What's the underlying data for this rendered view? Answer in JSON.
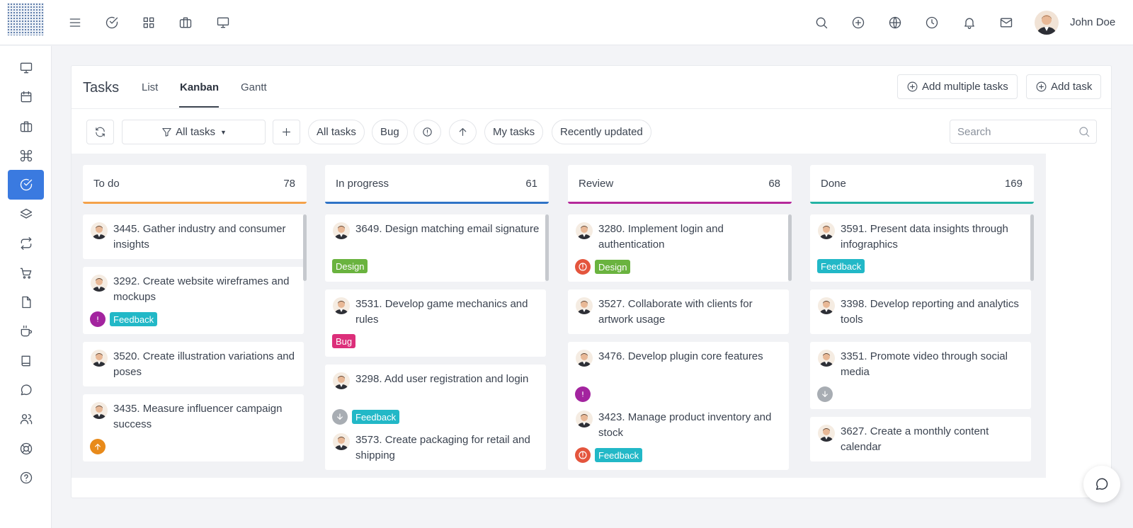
{
  "topbar": {
    "user_name": "John Doe",
    "left_icons": [
      "menu-icon",
      "check-circle-icon",
      "grid-icon",
      "briefcase-icon",
      "monitor-icon"
    ],
    "right_icons": [
      "search-icon",
      "plus-circle-icon",
      "globe-icon",
      "clock-icon",
      "bell-icon",
      "mail-icon"
    ]
  },
  "sidebar": {
    "items": [
      {
        "icon": "monitor-icon",
        "active": false
      },
      {
        "icon": "calendar-icon",
        "active": false
      },
      {
        "icon": "briefcase-icon",
        "active": false
      },
      {
        "icon": "command-icon",
        "active": false
      },
      {
        "icon": "check-circle-icon",
        "active": true
      },
      {
        "icon": "layers-icon",
        "active": false
      },
      {
        "icon": "repeat-icon",
        "active": false
      },
      {
        "icon": "cart-icon",
        "active": false
      },
      {
        "icon": "file-icon",
        "active": false
      },
      {
        "icon": "coffee-icon",
        "active": false
      },
      {
        "icon": "book-icon",
        "active": false
      },
      {
        "icon": "chat-icon",
        "active": false
      },
      {
        "icon": "users-icon",
        "active": false
      },
      {
        "icon": "lifebuoy-icon",
        "active": false
      },
      {
        "icon": "help-circle-icon",
        "active": false
      }
    ]
  },
  "header": {
    "title": "Tasks",
    "tabs": [
      {
        "label": "List",
        "active": false
      },
      {
        "label": "Kanban",
        "active": true
      },
      {
        "label": "Gantt",
        "active": false
      }
    ],
    "add_multiple_label": "Add multiple tasks",
    "add_task_label": "Add task"
  },
  "filters": {
    "dropdown_label": "All tasks",
    "pills": [
      "All tasks",
      "Bug",
      "My tasks",
      "Recently updated"
    ],
    "search_placeholder": "Search"
  },
  "colors": {
    "accent": "#3a7ae0",
    "todo": "#f4a24a",
    "in_progress": "#2f73c6",
    "review": "#b5299a",
    "done": "#24b3a4",
    "badge_design": "#6ab33f",
    "badge_feedback": "#22b8c7",
    "badge_bug": "#dc2f7a",
    "prio_urgent": "#e4553d",
    "prio_high": "#a3249f",
    "prio_medium": "#e88a1a",
    "prio_low": "#a8adb3"
  },
  "columns": [
    {
      "title": "To do",
      "count": "78",
      "cards": [
        {
          "title": "3445. Gather industry and consumer insights",
          "priority": null,
          "tags": []
        },
        {
          "title": "3292. Create website wireframes and mockups",
          "priority": "high",
          "tags": [
            "Feedback"
          ]
        },
        {
          "title": "3520. Create illustration variations and poses",
          "priority": null,
          "tags": []
        },
        {
          "title": "3435. Measure influencer campaign success",
          "priority": "medium",
          "tags": []
        }
      ]
    },
    {
      "title": "In progress",
      "count": "61",
      "cards": [
        {
          "title": "3649. Design matching email signature",
          "priority": null,
          "tags": [
            "Design"
          ]
        },
        {
          "title": "3531. Develop game mechanics and rules",
          "priority": null,
          "tags": [
            "Bug"
          ]
        },
        {
          "title": "3298. Add user registration and login",
          "priority": "low",
          "tags": [
            "Feedback"
          ]
        },
        {
          "title": "3573. Create packaging for retail and shipping",
          "priority": null,
          "tags": []
        }
      ]
    },
    {
      "title": "Review",
      "count": "68",
      "cards": [
        {
          "title": "3280. Implement login and authentication",
          "priority": "urgent",
          "tags": [
            "Design"
          ]
        },
        {
          "title": "3527. Collaborate with clients for artwork usage",
          "priority": null,
          "tags": []
        },
        {
          "title": "3476. Develop plugin core features",
          "priority": "high",
          "tags": []
        },
        {
          "title": "3423. Manage product inventory and stock",
          "priority": "urgent",
          "tags": [
            "Feedback"
          ]
        }
      ]
    },
    {
      "title": "Done",
      "count": "169",
      "cards": [
        {
          "title": "3591. Present data insights through infographics",
          "priority": null,
          "tags": [
            "Feedback"
          ]
        },
        {
          "title": "3398. Develop reporting and analytics tools",
          "priority": null,
          "tags": []
        },
        {
          "title": "3351. Promote video through social media",
          "priority": "low",
          "tags": []
        },
        {
          "title": "3627. Create a monthly content calendar",
          "priority": null,
          "tags": []
        }
      ]
    }
  ]
}
